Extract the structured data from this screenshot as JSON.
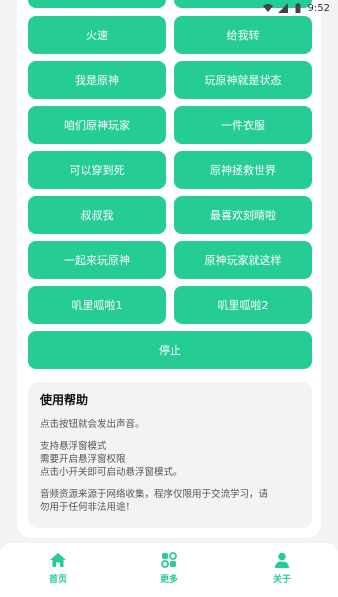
{
  "status_bar": {
    "time": "9:52"
  },
  "buttons": [
    {
      "label": "火速"
    },
    {
      "label": "给我转"
    },
    {
      "label": "我是原神"
    },
    {
      "label": "玩原神就是状态"
    },
    {
      "label": "咱们原神玩家"
    },
    {
      "label": "一件衣服"
    },
    {
      "label": "可以穿到死"
    },
    {
      "label": "原神拯救世界"
    },
    {
      "label": "叔叔我"
    },
    {
      "label": "最喜欢刻晴啦"
    },
    {
      "label": "一起来玩原神"
    },
    {
      "label": "原神玩家就这样"
    },
    {
      "label": "叽里呱啦1"
    },
    {
      "label": "叽里呱啦2"
    }
  ],
  "stop_label": "停止",
  "help": {
    "title": "使用帮助",
    "line1": "点击按钮就会发出声音。",
    "line2": "支持悬浮窗模式",
    "line3": "需要开启悬浮窗权限",
    "line4": "点击小开关即可启动悬浮窗模式。",
    "line5": "音频资源来源于网络收集，程序仅限用于交流学习，请",
    "line6": "勿用于任何非法用途！"
  },
  "nav": {
    "home": "首页",
    "more": "更多",
    "about": "关于"
  },
  "colors": {
    "accent": "#26cc96",
    "background": "#f3f4f2"
  }
}
